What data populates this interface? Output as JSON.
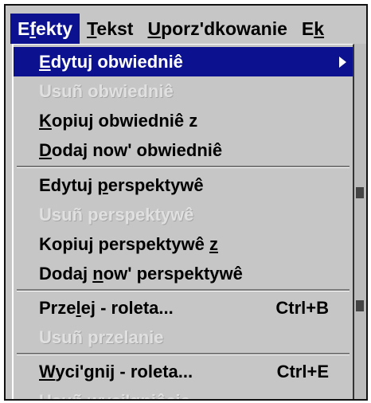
{
  "menubar": {
    "items": [
      {
        "prefix": "E",
        "mnemonic": "f",
        "suffix": "ekty",
        "active": true
      },
      {
        "prefix": "",
        "mnemonic": "T",
        "suffix": "ekst",
        "active": false
      },
      {
        "prefix": "",
        "mnemonic": "U",
        "suffix": "porz'dkowanie",
        "active": false
      },
      {
        "prefix": "E",
        "mnemonic": "k",
        "suffix": "",
        "active": false
      }
    ]
  },
  "menu": {
    "items": [
      {
        "prefix": "",
        "mnemonic": "E",
        "suffix": "dytuj obwiedniê",
        "shortcut": "",
        "submenu": true,
        "enabled": true,
        "highlighted": true
      },
      {
        "prefix": "Usuñ obwiedniê",
        "mnemonic": "",
        "suffix": "",
        "shortcut": "",
        "submenu": false,
        "enabled": false,
        "highlighted": false
      },
      {
        "prefix": "",
        "mnemonic": "K",
        "suffix": "opiuj obwiedniê z",
        "shortcut": "",
        "submenu": false,
        "enabled": true,
        "highlighted": false
      },
      {
        "prefix": "",
        "mnemonic": "D",
        "suffix": "odaj now' obwiedniê",
        "shortcut": "",
        "submenu": false,
        "enabled": true,
        "highlighted": false
      },
      {
        "prefix": "Edytuj ",
        "mnemonic": "p",
        "suffix": "erspektywê",
        "shortcut": "",
        "submenu": false,
        "enabled": true,
        "highlighted": false
      },
      {
        "prefix": "Usuñ perspektywê",
        "mnemonic": "",
        "suffix": "",
        "shortcut": "",
        "submenu": false,
        "enabled": false,
        "highlighted": false
      },
      {
        "prefix": "Kopiuj perspektywê ",
        "mnemonic": "z",
        "suffix": "",
        "shortcut": "",
        "submenu": false,
        "enabled": true,
        "highlighted": false
      },
      {
        "prefix": "Dodaj ",
        "mnemonic": "n",
        "suffix": "ow' perspektywê",
        "shortcut": "",
        "submenu": false,
        "enabled": true,
        "highlighted": false
      },
      {
        "prefix": "Prze",
        "mnemonic": "l",
        "suffix": "ej - roleta...",
        "shortcut": "Ctrl+B",
        "submenu": false,
        "enabled": true,
        "highlighted": false
      },
      {
        "prefix": "Usuñ przelanie",
        "mnemonic": "",
        "suffix": "",
        "shortcut": "",
        "submenu": false,
        "enabled": false,
        "highlighted": false
      },
      {
        "prefix": "",
        "mnemonic": "W",
        "suffix": "yci'gnij - roleta...",
        "shortcut": "Ctrl+E",
        "submenu": false,
        "enabled": true,
        "highlighted": false
      },
      {
        "prefix": "Usuñ wyci'gniêcie",
        "mnemonic": "",
        "suffix": "",
        "shortcut": "",
        "submenu": false,
        "enabled": false,
        "highlighted": false
      }
    ]
  },
  "colors": {
    "highlight": "#0c128f",
    "face": "#c6c6c6",
    "disabled_text": "#e0e0e0"
  }
}
